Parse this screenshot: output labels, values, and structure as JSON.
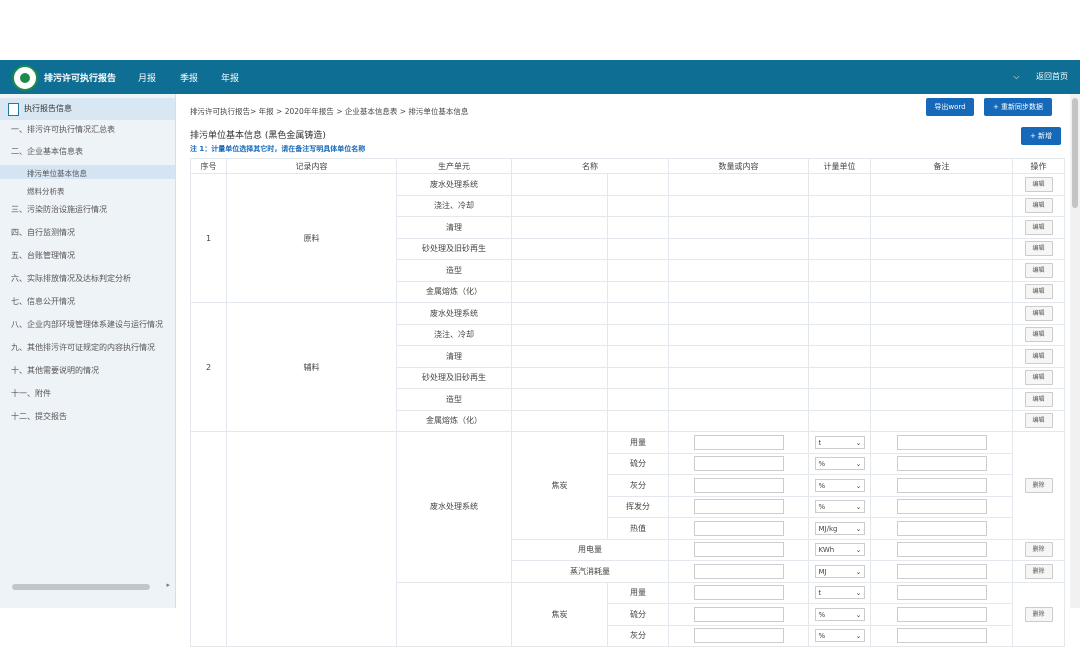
{
  "header": {
    "app_title": "排污许可执行报告",
    "nav": [
      "月报",
      "季报",
      "年报"
    ],
    "home_link": "返回首页",
    "chevron": "⌵"
  },
  "sidebar": {
    "head": "执行报告信息",
    "items": [
      "一、排污许可执行情况汇总表",
      "二、企业基本信息表",
      "三、污染防治设施运行情况",
      "四、自行监测情况",
      "五、台账管理情况",
      "六、实际排放情况及达标判定分析",
      "七、信息公开情况",
      "八、企业内部环境管理体系建设与运行情况",
      "九、其他排污许可证规定的内容执行情况",
      "十、其他需要说明的情况",
      "十一、附件",
      "十二、提交报告"
    ],
    "sub_items": [
      "排污单位基本信息",
      "燃料分析表"
    ]
  },
  "breadcrumb": "排污许可执行报告> 年报 > 2020年年报告 > 企业基本信息表 > 排污单位基本信息",
  "buttons": {
    "export_word": "导出word",
    "sync": "+ 重新同步数据",
    "add": "+ 新增"
  },
  "section_title": "排污单位基本信息 (黑色金属铸造)",
  "note": "注 1：计量单位选择其它时，请在备注写明具体单位名称",
  "table": {
    "headers": [
      "序号",
      "记录内容",
      "生产单元",
      "名称",
      "数量或内容",
      "计量单位",
      "备注",
      "操作"
    ],
    "edit_label": "编辑",
    "delete_label": "删除",
    "groups": [
      {
        "index": "1",
        "content": "原料",
        "units": [
          "废水处理系统",
          "浇注、冷却",
          "清理",
          "砂处理及旧砂再生",
          "造型",
          "金属熔炼（化）"
        ]
      },
      {
        "index": "2",
        "content": "辅料",
        "units": [
          "废水处理系统",
          "浇注、冷却",
          "清理",
          "砂处理及旧砂再生",
          "造型",
          "金属熔炼（化）"
        ]
      }
    ],
    "group3": {
      "unit": "废水处理系统",
      "coke": "焦炭",
      "props": [
        "用量",
        "硫分",
        "灰分",
        "挥发分",
        "热值"
      ],
      "prop_units": [
        "t",
        "%",
        "%",
        "%",
        "MJ/kg"
      ],
      "electricity": "用电量",
      "electricity_unit": "KWh",
      "steam": "蒸汽消耗量",
      "steam_unit": "MJ",
      "next_props": [
        "用量",
        "硫分",
        "灰分"
      ],
      "next_units": [
        "t",
        "%",
        "%"
      ]
    }
  }
}
